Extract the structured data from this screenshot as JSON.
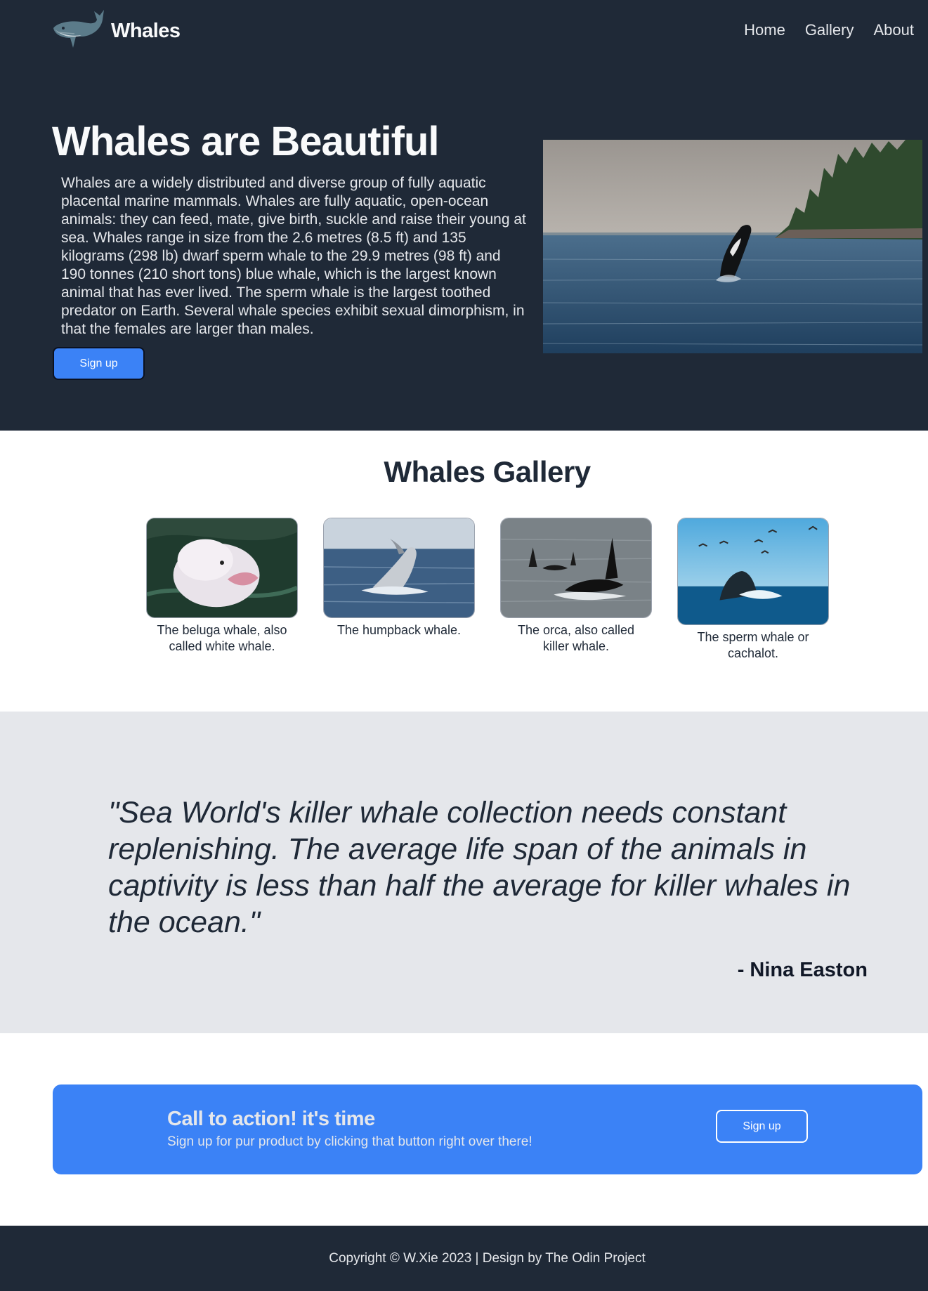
{
  "header": {
    "brand": "Whales",
    "logo_icon": "whale-icon",
    "nav": [
      {
        "label": "Home"
      },
      {
        "label": "Gallery"
      },
      {
        "label": "About"
      }
    ]
  },
  "hero": {
    "title": "Whales are Beautiful",
    "text": "Whales are a widely distributed and diverse group of fully aquatic placental marine mammals. Whales are fully aquatic, open-ocean animals: they can feed, mate, give birth, suckle and raise their young at sea. Whales range in size from the 2.6 metres (8.5 ft) and 135 kilograms (298 lb) dwarf sperm whale to the 29.9 metres (98 ft) and 190 tonnes (210 short tons) blue whale, which is the largest known animal that has ever lived. The sperm whale is the largest toothed predator on Earth. Several whale species exhibit sexual dimorphism, in that the females are larger than males.",
    "button_label": "Sign up"
  },
  "gallery": {
    "title": "Whales Gallery",
    "items": [
      {
        "caption": "The beluga whale, also called white whale."
      },
      {
        "caption": "The humpback whale."
      },
      {
        "caption": "The orca, also called killer whale."
      },
      {
        "caption": "The sperm whale or cachalot."
      }
    ]
  },
  "quote": {
    "text": "\"Sea World's killer whale collection needs constant replenishing. The average life span of the animals in captivity is less than half the average for killer whales in the ocean.\"",
    "author": "- Nina Easton"
  },
  "cta": {
    "title": "Call to action! it's time",
    "subtitle": "Sign up for pur product by clicking that button right over there!",
    "button_label": "Sign up"
  },
  "footer": {
    "text": "Copyright © W.Xie 2023 | Design by The Odin Project"
  },
  "colors": {
    "dark": "#1f2937",
    "accent": "#3b82f6",
    "light_gray": "#e5e7eb"
  }
}
